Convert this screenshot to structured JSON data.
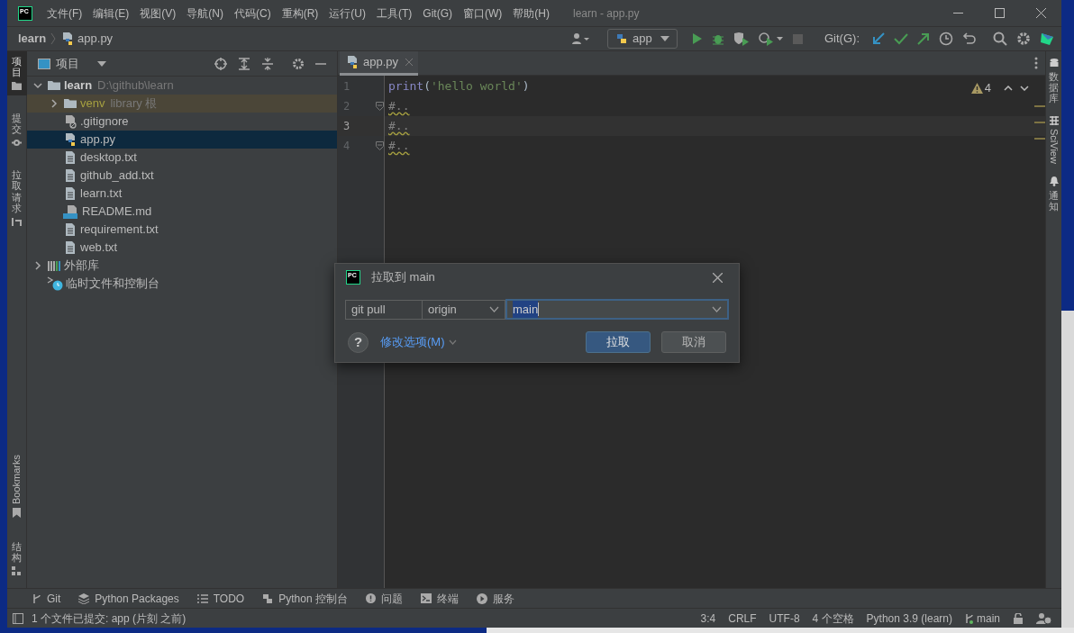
{
  "app_logo": "PC",
  "menu": [
    "文件(F)",
    "编辑(E)",
    "视图(V)",
    "导航(N)",
    "代码(C)",
    "重构(R)",
    "运行(U)",
    "工具(T)",
    "Git(G)",
    "窗口(W)",
    "帮助(H)"
  ],
  "window_title": "learn - app.py",
  "breadcrumb": [
    "learn",
    "app.py"
  ],
  "run_config": "app",
  "git_label": "Git(G):",
  "left_tools": [
    {
      "label": "项目",
      "kind": "cjk",
      "selected": true
    },
    {
      "label": "提交",
      "kind": "cjk",
      "selected": false
    },
    {
      "label": "拉取请求",
      "kind": "cjk",
      "selected": false
    },
    {
      "label": "Bookmarks",
      "kind": "latin",
      "selected": false
    },
    {
      "label": "结构",
      "kind": "cjk",
      "selected": false
    }
  ],
  "project_panel": {
    "title": "项目",
    "tree": [
      {
        "name": "learn",
        "path": "D:\\github\\learn",
        "kind": "folder",
        "expanded": true,
        "selected": false,
        "children": [
          {
            "name": "venv",
            "note": "library 根",
            "kind": "library_root",
            "expanded": false,
            "selected": false
          },
          {
            "name": ".gitignore",
            "kind": "ignore_file",
            "selected": false
          },
          {
            "name": "app.py",
            "kind": "python",
            "selected": true
          },
          {
            "name": "desktop.txt",
            "kind": "text",
            "selected": false
          },
          {
            "name": "github_add.txt",
            "kind": "text",
            "selected": false
          },
          {
            "name": "learn.txt",
            "kind": "text",
            "selected": false
          },
          {
            "name": "README.md",
            "kind": "markdown",
            "selected": false
          },
          {
            "name": "requirement.txt",
            "kind": "text",
            "selected": false
          },
          {
            "name": "web.txt",
            "kind": "text",
            "selected": false
          }
        ]
      },
      {
        "name": "外部库",
        "kind": "library",
        "expanded": false,
        "selected": false
      },
      {
        "name": "临时文件和控制台",
        "kind": "scratch",
        "selected": false
      }
    ]
  },
  "editor": {
    "tab": "app.py",
    "warnings": "4",
    "lines": [
      {
        "number": "1",
        "current": false,
        "fold": false,
        "tokens": [
          {
            "text": "print",
            "kind": "builtin"
          },
          {
            "text": "(",
            "kind": "plain"
          },
          {
            "text": "'hello world'",
            "kind": "string"
          },
          {
            "text": ")",
            "kind": "plain"
          }
        ]
      },
      {
        "number": "2",
        "current": false,
        "fold": true,
        "tokens": [
          {
            "text": "#..",
            "kind": "folded"
          }
        ]
      },
      {
        "number": "3",
        "current": true,
        "fold": false,
        "tokens": [
          {
            "text": "#..",
            "kind": "folded"
          }
        ]
      },
      {
        "number": "4",
        "current": false,
        "fold": true,
        "tokens": [
          {
            "text": "#..",
            "kind": "folded"
          }
        ]
      }
    ]
  },
  "right_tools": [
    {
      "label": "数据库",
      "kind": "cjk"
    },
    {
      "label": "SciView",
      "kind": "latin"
    },
    {
      "label": "通知",
      "kind": "cjk"
    }
  ],
  "bottom_tools": [
    {
      "label": "Git",
      "kind": "git"
    },
    {
      "label": "Python Packages",
      "kind": "packages"
    },
    {
      "label": "TODO",
      "kind": "todo"
    },
    {
      "label": "Python 控制台",
      "kind": "console"
    },
    {
      "label": "问题",
      "kind": "problems"
    },
    {
      "label": "终端",
      "kind": "terminal"
    },
    {
      "label": "服务",
      "kind": "services"
    }
  ],
  "status": {
    "message": "1 个文件已提交: app (片刻 之前)",
    "items": [
      "3:4",
      "CRLF",
      "UTF-8",
      "4 个空格",
      "Python 3.9 (learn)"
    ],
    "branch": "main"
  },
  "dialog": {
    "logo": "PC",
    "title": "拉取到 main",
    "command": "git pull",
    "remote": "origin",
    "branch": "main",
    "help": "?",
    "options_link": "修改选项(M)",
    "buttons": [
      {
        "label": "拉取",
        "primary": true
      },
      {
        "label": "取消",
        "primary": false
      }
    ]
  }
}
